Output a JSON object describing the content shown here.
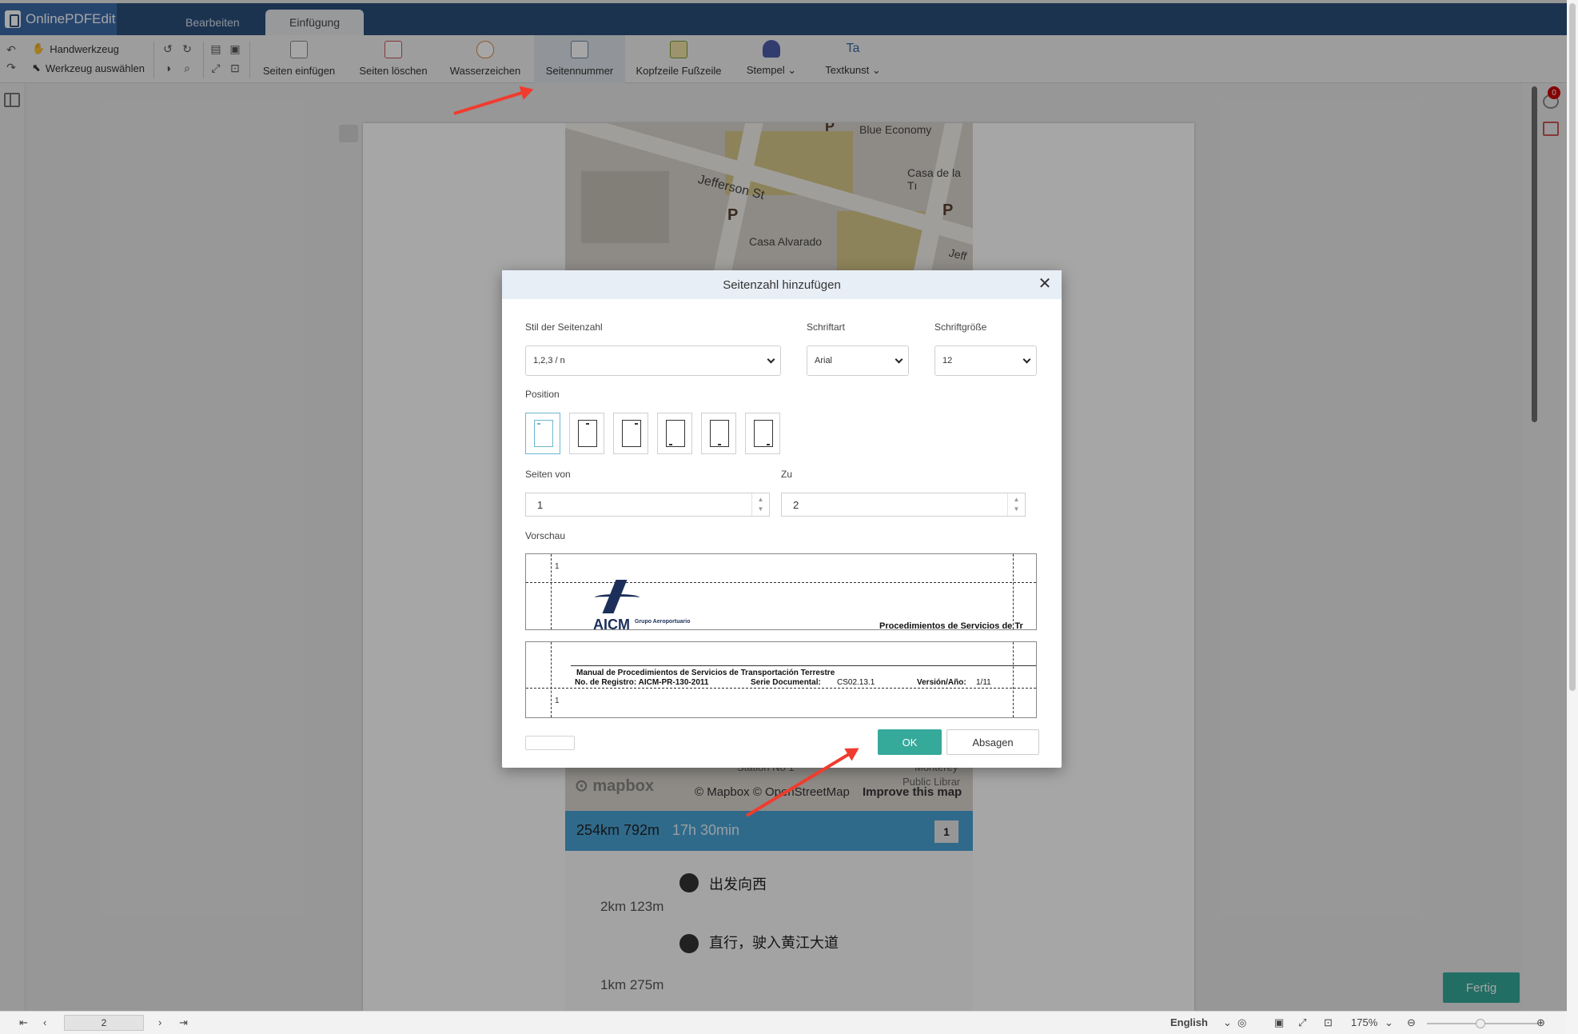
{
  "app": {
    "name": "OnlinePDFEdit"
  },
  "tabs": [
    {
      "label": "Bearbeiten"
    },
    {
      "label": "Einfügung"
    }
  ],
  "toolbar": {
    "hand_tool": "Handwerkzeug",
    "select_tool": "Werkzeug auswählen",
    "buttons": [
      {
        "label": "Seiten einfügen"
      },
      {
        "label": "Seiten löschen"
      },
      {
        "label": "Wasserzeichen"
      },
      {
        "label": "Seitennummer"
      },
      {
        "label": "Kopfzeile Fußzeile"
      },
      {
        "label": "Stempel"
      },
      {
        "label": "Textkunst"
      }
    ]
  },
  "notifications": {
    "count": "0"
  },
  "map": {
    "labels": [
      "Blue Economy",
      "Jefferson St",
      "Casa de la Tı",
      "Casa Alvarado",
      "Jeff",
      "P",
      "P",
      "P",
      "Station No 1",
      "Monterey",
      "Public Librar"
    ],
    "attribution": "© Mapbox © OpenStreetMap",
    "improve": "Improve this map",
    "mapbox_logo": "mapbox"
  },
  "route": {
    "distance": "254km 792m",
    "duration": "17h 30min",
    "index": "1",
    "steps": [
      {
        "instruction": "出发向西",
        "distance": "2km 123m"
      },
      {
        "instruction": "直行，驶入黄江大道",
        "distance": "1km 275m"
      }
    ]
  },
  "dialog": {
    "title": "Seitenzahl hinzufügen",
    "style_label": "Stil der Seitenzahl",
    "style_value": "1,2,3 / n",
    "font_label": "Schriftart",
    "font_value": "Arial",
    "size_label": "Schriftgröße",
    "size_value": "12",
    "position_label": "Position",
    "pages_from_label": "Seiten von",
    "pages_from_value": "1",
    "to_label": "Zu",
    "to_value": "2",
    "preview_label": "Vorschau",
    "preview_top": {
      "page_number": "1",
      "brand": "AICM",
      "brand_sub": "Grupo Aeroportuario",
      "heading": "Procedimientos de Servicios de Tr"
    },
    "preview_bottom": {
      "page_number": "1",
      "line1": "Manual de Procedimientos de Servicios de Transportación Terrestre",
      "registro": "No. de Registro: AICM-PR-130-2011",
      "serie": "Serie Documental:",
      "serie_value": "CS02.13.1",
      "version": "Versión/Año:",
      "version_value": "1/11"
    },
    "ok_label": "OK",
    "cancel_label": "Absagen"
  },
  "fertig_label": "Fertig",
  "status": {
    "page": "2",
    "language": "English",
    "zoom": "175%"
  },
  "colors": {
    "accent": "#35a99a",
    "header": "#2c4f7c",
    "annotation_arrow": "#f03c2e"
  }
}
